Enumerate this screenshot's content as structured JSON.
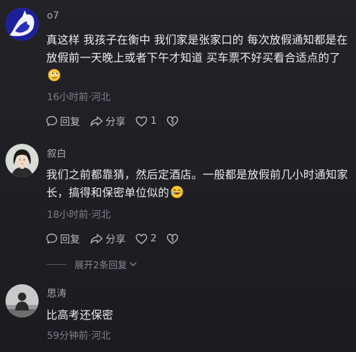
{
  "comments": [
    {
      "username": "o7",
      "text": "真这样 我孩子在衡中 我们家是张家口的 每次放假通知都是在放假前一天晚上或者下午才知道 买车票不好买看合适点的了",
      "emoji": "smirk-face-emoji",
      "meta": "16小时前·河北",
      "reply_label": "回复",
      "share_label": "分享",
      "like_count": "1"
    },
    {
      "username": "叙白",
      "text": "我们之前都靠猜，然后定酒店。一般都是放假前几小时通知家长，搞得和保密单位似的",
      "emoji": "laugh-cry-emoji",
      "meta": "18小时前·河北",
      "reply_label": "回复",
      "share_label": "分享",
      "like_count": "2"
    },
    {
      "username": "思涛",
      "text": "比高考还保密",
      "meta": "59分钟前·河北"
    }
  ],
  "expand_replies_label": "展开2条回复",
  "colors": {
    "background": "#222226",
    "text": "#ebebee",
    "muted": "#7f7f86"
  }
}
